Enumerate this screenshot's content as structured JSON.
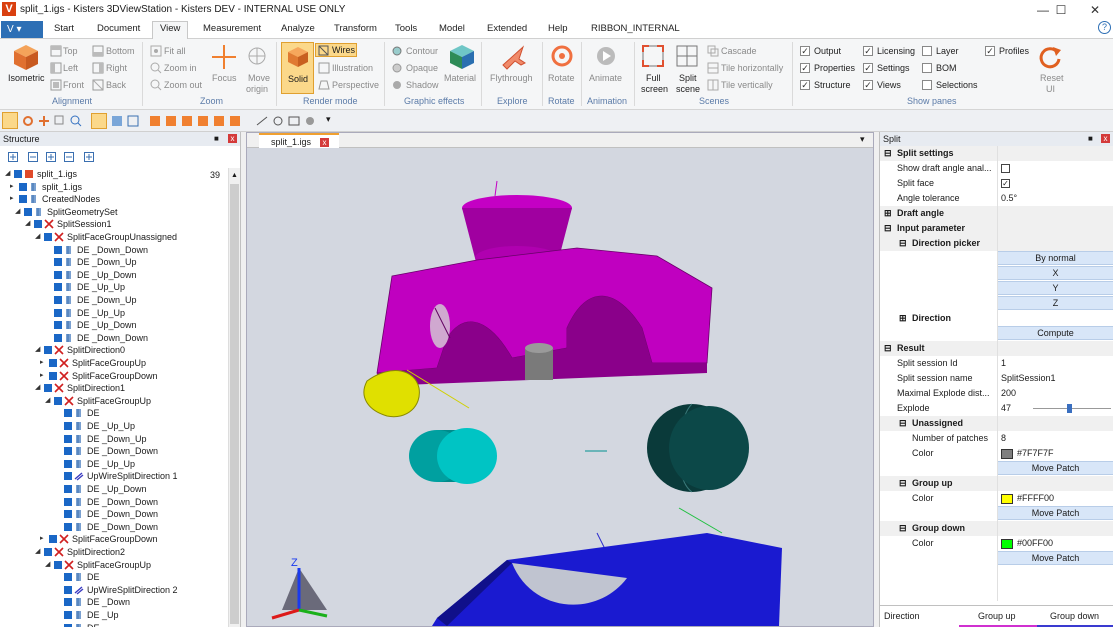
{
  "titlebar": {
    "logo": "V",
    "title": "split_1.igs - Kisters 3DViewStation - Kisters DEV - INTERNAL USE ONLY",
    "minimize": "—",
    "maximize": "☐",
    "close": "✕"
  },
  "menu": {
    "app_button": "V ▾",
    "tabs": [
      "Start",
      "Document",
      "View",
      "Measurement",
      "Analyze",
      "Transform",
      "Tools",
      "Model",
      "Extended",
      "Help",
      "RIBBON_INTERNAL"
    ],
    "help_icon": "?"
  },
  "ribbon": {
    "alignment": {
      "iso_label": "Isometric",
      "top": "Top",
      "bottom": "Bottom",
      "left": "Left",
      "right": "Right",
      "front": "Front",
      "back": "Back",
      "group": "Alignment"
    },
    "zoom": {
      "fit_all": "Fit all",
      "zoom_in": "Zoom in",
      "zoom_out": "Zoom out",
      "focus": "Focus",
      "move_origin_1": "Move",
      "move_origin_2": "origin",
      "group": "Zoom"
    },
    "render": {
      "solid": "Solid",
      "wires": "Wires",
      "illustration": "Illustration",
      "perspective": "Perspective",
      "group": "Render mode"
    },
    "effects": {
      "contour": "Contour",
      "opaque": "Opaque",
      "shadow": "Shadow",
      "material": "Material",
      "group": "Graphic effects"
    },
    "explore": {
      "flythrough": "Flythrough",
      "group": "Explore"
    },
    "rotate": {
      "rotate": "Rotate",
      "group": "Rotate"
    },
    "animation": {
      "animate": "Animate",
      "group": "Animation"
    },
    "scenes": {
      "full_1": "Full",
      "full_2": "screen",
      "split_1": "Split",
      "split_2": "scene",
      "cascade": "Cascade",
      "tile_h": "Tile horizontally",
      "tile_v": "Tile vertically",
      "group": "Scenes"
    },
    "panes": {
      "output": "Output",
      "properties": "Properties",
      "structure": "Structure",
      "licensing": "Licensing",
      "settings": "Settings",
      "views": "Views",
      "layer": "Layer",
      "bom": "BOM",
      "selections": "Selections",
      "profiles": "Profiles",
      "group": "Show panes",
      "reset_1": "Reset",
      "reset_2": "UI",
      "check": "✓"
    }
  },
  "structure": {
    "title": "Structure",
    "pin": "■",
    "close": "x",
    "count": "39",
    "rows": [
      "split_1.igs",
      "split_1.igs",
      "CreatedNodes",
      "SplitGeometrySet",
      "SplitSession1",
      "SplitFaceGroupUnassigned",
      "DE     _Down_Down",
      "DE     _Down_Up",
      "DE     _Up_Down",
      "DE     _Up_Up",
      "DE     _Down_Up",
      "DE     _Up_Up",
      "DE     _Up_Down",
      "DE     _Down_Down",
      "SplitDirection0",
      "SplitFaceGroupUp",
      "SplitFaceGroupDown",
      "SplitDirection1",
      "SplitFaceGroupUp",
      "DE",
      "DE     _Up_Up",
      "DE     _Down_Up",
      "DE     _Down_Down",
      "DE     _Up_Up",
      "UpWireSplitDirection 1",
      "DE     _Up_Down",
      "DE     _Down_Down",
      "DE     _Down_Down",
      "DE     _Down_Down",
      "SplitFaceGroupDown",
      "SplitDirection2",
      "SplitFaceGroupUp",
      "DE",
      "UpWireSplitDirection 2",
      "DE     _Down",
      "DE     _Up",
      "DE"
    ]
  },
  "viewport": {
    "tab": "split_1.igs",
    "close": "x",
    "dropdown": "▾",
    "axis_z": "Z",
    "colors": {
      "magenta": "#c400c4",
      "yellow": "#e6e600",
      "cyan": "#00c4c4",
      "blue": "#1a1acc",
      "gray": "#7f7f7f"
    }
  },
  "split": {
    "title": "Split",
    "pin": "■",
    "close": "x",
    "settings_cat": "Split settings",
    "draft_lbl": "Show draft angle anal...",
    "split_face_lbl": "Split face",
    "angle_tol_lbl": "Angle tolerance",
    "angle_tol": "0.5°",
    "check": "✓",
    "draft_cat": "Draft angle",
    "input_cat": "Input parameter",
    "dir_picker": "Direction picker",
    "by_normal": "By normal",
    "x": "X",
    "y": "Y",
    "z": "Z",
    "direction": "Direction",
    "compute": "Compute",
    "result_cat": "Result",
    "sid_lbl": "Split session Id",
    "sid": "1",
    "sname_lbl": "Split session name",
    "sname": "SplitSession1",
    "maxexp_lbl": "Maximal Explode dist...",
    "maxexp": "200",
    "explode_lbl": "Explode",
    "explode": "47",
    "explode_fraction": 0.235,
    "unassigned": "Unassigned",
    "patches_lbl": "Number of patches",
    "patches": "8",
    "color_lbl": "Color",
    "unassigned_color": "#7F7F7F",
    "move_patch": "Move Patch",
    "group_up": "Group up",
    "up_color": "#FFFF00",
    "group_down": "Group down",
    "down_color": "#00FF00",
    "footer_tabs": [
      "Direction",
      "Group up",
      "Group down"
    ]
  }
}
